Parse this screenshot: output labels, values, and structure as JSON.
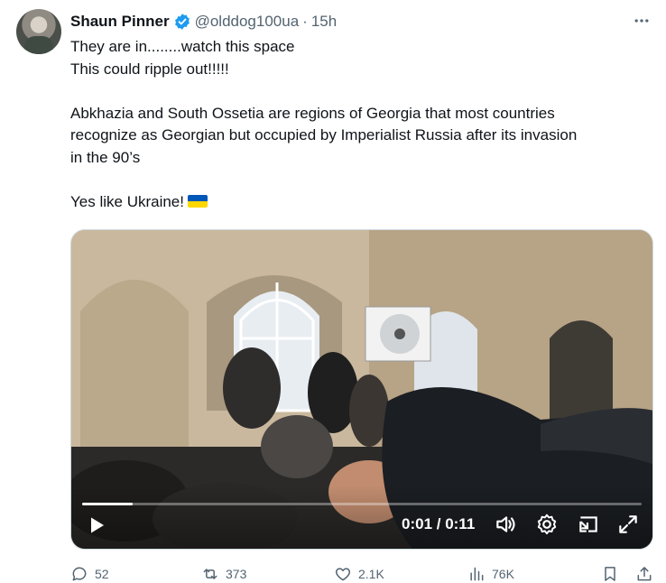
{
  "tweet": {
    "author_name": "Shaun Pinner",
    "handle": "@olddog100ua",
    "separator": "·",
    "time": "15h",
    "lines": [
      "They are in........watch this space",
      "This could ripple out!!!!!",
      "",
      "Abkhazia and South Ossetia are regions of Georgia that most countries",
      "recognize as Georgian but occupied by Imperialist Russia after its invasion",
      "in the 90’s",
      "",
      "Yes like Ukraine!"
    ],
    "flag_colors": [
      "#0057b7",
      "#ffd700"
    ],
    "accent_color": "#1d9bf0"
  },
  "video": {
    "timecode": "0:01 / 0:11",
    "progress": 0.09,
    "icons": [
      "play-icon",
      "volume-icon",
      "settings-gear-icon",
      "picture-in-picture-icon",
      "fullscreen-icon"
    ]
  },
  "actions": {
    "replies": "52",
    "reposts": "373",
    "likes": "2.1K",
    "views": "76K"
  }
}
